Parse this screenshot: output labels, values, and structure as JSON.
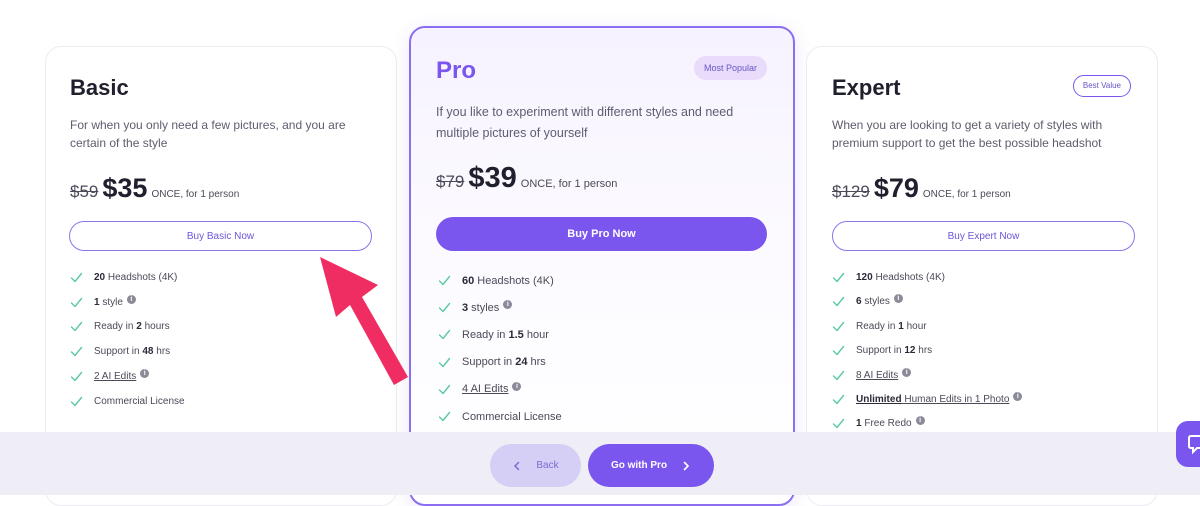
{
  "plans": {
    "basic": {
      "title": "Basic",
      "description": "For when you only need a few pictures, and you are certain of the style",
      "old_price": "$59",
      "price": "$35",
      "price_note": "ONCE, for 1 person",
      "button": "Buy Basic Now",
      "features": [
        {
          "bold": "20",
          "text": " Headshots (4K)"
        },
        {
          "bold": "1",
          "text": " style"
        },
        {
          "pre": "Ready in ",
          "bold": "2",
          "text": " hours"
        },
        {
          "pre": "Support in ",
          "bold": "48",
          "text": " hrs"
        },
        {
          "link": "2 AI Edits"
        },
        {
          "text": "Commercial License"
        }
      ]
    },
    "pro": {
      "title": "Pro",
      "badge": "Most Popular",
      "description": "If you like to experiment with different styles and need multiple pictures of yourself",
      "old_price": "$79",
      "price": "$39",
      "price_note": "ONCE, for 1 person",
      "button": "Buy Pro Now",
      "features": [
        {
          "bold": "60",
          "text": " Headshots (4K)"
        },
        {
          "bold": "3",
          "text": " styles"
        },
        {
          "pre": "Ready in ",
          "bold": "1.5",
          "text": " hour"
        },
        {
          "pre": "Support in ",
          "bold": "24",
          "text": " hrs"
        },
        {
          "link": "4 AI Edits"
        },
        {
          "text": "Commercial License"
        }
      ]
    },
    "expert": {
      "title": "Expert",
      "badge": "Best Value",
      "description": "When you are looking to get a variety of styles with premium support to get the best possible headshot",
      "old_price": "$129",
      "price": "$79",
      "price_note": "ONCE, for 1 person",
      "button": "Buy Expert Now",
      "features": [
        {
          "bold": "120",
          "text": " Headshots (4K)"
        },
        {
          "bold": "6",
          "text": " styles"
        },
        {
          "pre": "Ready in ",
          "bold": "1",
          "text": " hour"
        },
        {
          "pre": "Support in ",
          "bold": "12",
          "text": " hrs"
        },
        {
          "link": "8 AI Edits"
        },
        {
          "link_bold": "Unlimited",
          "link": " Human Edits in 1 Photo"
        },
        {
          "bold": "1",
          "text": " Free Redo"
        }
      ]
    }
  },
  "footer": {
    "back_label": "Back",
    "go_label": "Go with Pro"
  },
  "colors": {
    "accent": "#7a56ee",
    "check": "#5cc9a3",
    "annotation_arrow": "#f02d62"
  },
  "icons": [
    "check-icon",
    "info-icon",
    "chevron-left-icon",
    "chevron-right-icon",
    "chat-icon",
    "annotation-arrow"
  ]
}
